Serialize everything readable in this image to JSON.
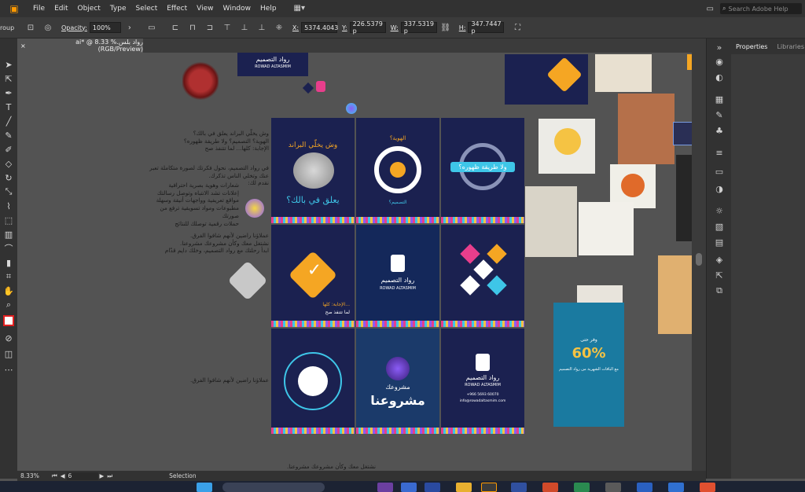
{
  "menu": {
    "items": [
      "File",
      "Edit",
      "Object",
      "Type",
      "Select",
      "Effect",
      "View",
      "Window",
      "Help"
    ],
    "search_placeholder": "Search Adobe Help"
  },
  "control": {
    "group_label": "roup",
    "opacity_label": "Opacity:",
    "opacity_value": "100%",
    "x_label": "X:",
    "x_value": "5374.4043",
    "y_label": "Y:",
    "y_value": "226.5379 p",
    "w_label": "W:",
    "w_value": "337.5319 p",
    "h_label": "H:",
    "h_value": "347.7447 p"
  },
  "document": {
    "tab_title": "رواد بلس.ai* @ 8.33 % (RGB/Preview)",
    "close": "×"
  },
  "panel": {
    "tabs": [
      "Properties",
      "Libraries"
    ]
  },
  "status": {
    "zoom": "8.33%",
    "page": "6",
    "mode": "Selection"
  },
  "canvas_text": {
    "note1": [
      "وش يخلّي البراند يعلق في بالك؟",
      "الهوية؟ التصميم؟ ولا طريقة ظهوره؟",
      "الإجابة: كلها... لما تتنفذ صح"
    ],
    "note2": [
      "في رواد التصميم، نحول فكرتك لصورة متكاملة تعبر عنك وتخلي الناس تذكرك.",
      "نقدم لك:"
    ],
    "services": [
      "شعارات وهوية بصرية احترافية",
      "إعلانات تشد الانتباه وتوصل رسالتك",
      "مواقع تعريفية وواجهات أنيقة وسهلة",
      "مطبوعات ومواد تسويقية ترفع من صورتك",
      "حملات رقمية توصلك للنتائج"
    ],
    "note3": [
      "عملاؤنا راضين لأنهم شافوا الفرق.",
      "نشتغل معك وكأن مشروعك مشروعنا.",
      "ابدأ رحلتك مع رواد التصميم، وخلك دايم قدّام"
    ],
    "note4": "عملاؤنا راضين لأنهم شافوا الفرق.",
    "note5": "نشتغل معك وكأن مشروعك مشروعنا.",
    "brand_ar": "رواد التصميم",
    "brand_en": "ROWAD ALTASMIM",
    "ab1_title": "وش يخلّي البراند",
    "ab1_sub": "يعلق في بالك؟",
    "ab2_title": "الهوية؟",
    "ab2_sub": "التصميم؟",
    "ab3_title": "ولا طريقة ظهوره؟",
    "ab5_text": "الإجابة: كلها...",
    "ab5_sub": "لما تتنفذ صح",
    "ab8_text": "مشروعك",
    "ab8_big": "مشروعنا",
    "ab9_phone": "+966 5693 60070",
    "ab9_web": "info@rowadaltasmim.com",
    "poster_title": "60%",
    "poster_sub": "وفر حتى",
    "poster_text": "مع الباقات الشهرية من رواد التصميم"
  },
  "colors": {
    "artboard": "#1b2150",
    "accent_orange": "#f5a623",
    "accent_pink": "#e83e8c",
    "accent_cyan": "#3ec6e8",
    "app_orange": "#ff9a00"
  }
}
